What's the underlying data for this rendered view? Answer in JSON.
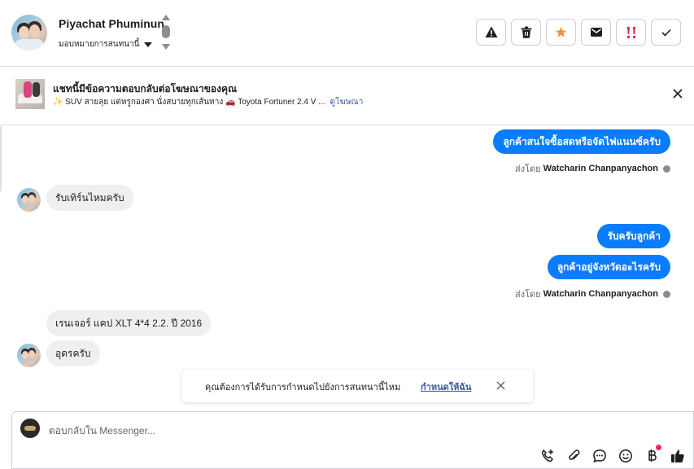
{
  "header": {
    "contact_name": "Piyachat Phuminun",
    "assign_label": "มอบหมายการสนทนานี้",
    "actions": [
      {
        "name": "spam-button",
        "icon": "warning-icon"
      },
      {
        "name": "delete-button",
        "icon": "trash-icon"
      },
      {
        "name": "star-button",
        "icon": "star-icon"
      },
      {
        "name": "mark-unread-button",
        "icon": "envelope-icon"
      },
      {
        "name": "follow-up-button",
        "icon": "double-exclamation-icon"
      },
      {
        "name": "done-button",
        "icon": "checkmark-icon"
      }
    ],
    "colors": {
      "star": "#f7923b",
      "followup": "#e41e3f"
    }
  },
  "ad_banner": {
    "title": "แชทนี้มีข้อความตอบกลับต่อโฆษณาของคุณ",
    "subtitle": "✨ SUV สายลุย แต่หรูกองศา นั่งสบายทุกเส้นทาง 🚗 Toyota Fortuner 2.4 V ...",
    "link": "ดูโฆษณา"
  },
  "messages": {
    "out_1": "ลูกค้าสนใจซื้อสดหรือจัดไฟแนนซ์ครับ",
    "sent_by_1_prefix": "ส่งโดย",
    "sent_by_1_name": "Watcharin Chanpanyachon",
    "in_1": "รับเทิร์นไหมครับ",
    "out_2": "รับครับลูกค้า",
    "out_3": "ลูกค้าอยู่จังหวัดอะไรครับ",
    "sent_by_2_prefix": "ส่งโดย",
    "sent_by_2_name": "Watcharin Chanpanyachon",
    "in_2": "เรนเจอร์ แคป XLT 4*4 2.2. ปี 2016",
    "in_3": "อุดรครับ"
  },
  "toast": {
    "text": "คุณต้องการได้รับการกำหนดไปยังการสนทนานี้ไหม",
    "link": "กำหนดให้ฉัน"
  },
  "composer": {
    "placeholder": "ตอบกลับใน Messenger...",
    "tools": [
      "call-add-icon",
      "attachment-icon",
      "saved-reply-icon",
      "emoji-icon",
      "payment-icon",
      "thumbs-up-icon"
    ]
  },
  "colors": {
    "accent": "#0a7cff",
    "link": "#385898",
    "notification": "#f02849"
  }
}
